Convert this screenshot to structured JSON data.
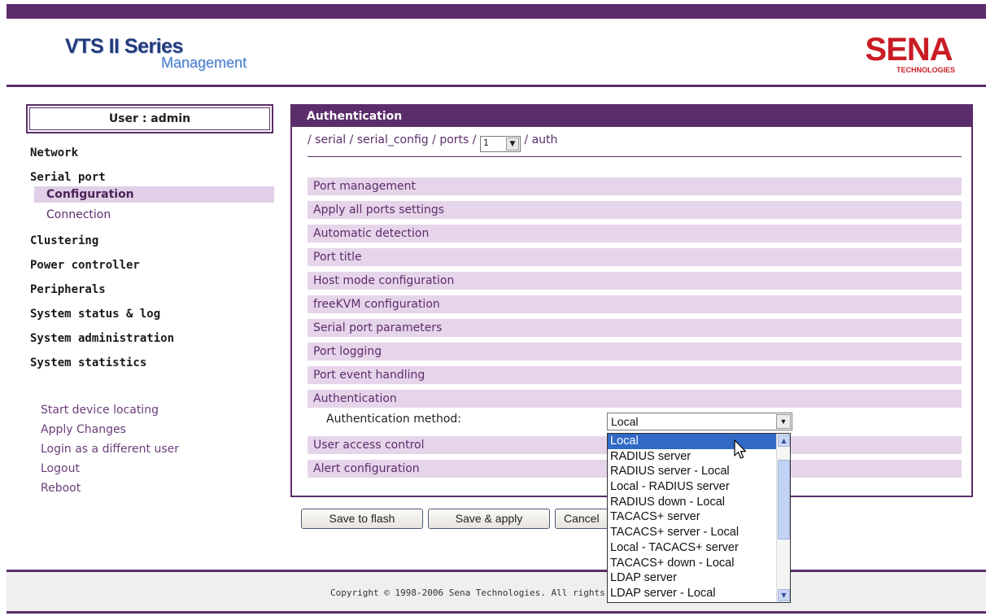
{
  "header": {
    "product_line1": "VTS II Series",
    "product_line2": "Management",
    "company_big": "SENA",
    "company_small": "TECHNOLOGIES"
  },
  "sidebar": {
    "user_label": "User : admin",
    "network": "Network",
    "serial_port": "Serial port",
    "serial_sub": {
      "configuration": "Configuration",
      "connection": "Connection"
    },
    "clustering": "Clustering",
    "power_controller": "Power controller",
    "peripherals": "Peripherals",
    "system_status": "System status & log",
    "system_admin": "System administration",
    "system_stats": "System statistics",
    "links": {
      "start_locating": "Start device locating",
      "apply_changes": "Apply Changes",
      "login_different": "Login as a different user",
      "logout": "Logout",
      "reboot": "Reboot"
    }
  },
  "panel": {
    "title": "Authentication",
    "breadcrumb": {
      "p1": "serial",
      "p2": "serial_config",
      "p3": "ports",
      "port_value": "1",
      "p4": "auth"
    },
    "sections": {
      "s1": "Port management",
      "s2": "Apply all ports settings",
      "s3": "Automatic detection",
      "s4": "Port title",
      "s5": "Host mode configuration",
      "s6": "freeKVM configuration",
      "s7": "Serial port parameters",
      "s8": "Port logging",
      "s9": "Port event handling",
      "s10": "Authentication",
      "s11": "User access control",
      "s12": "Alert configuration"
    },
    "auth_method_label": "Authentication method:",
    "auth_method_value": "Local"
  },
  "buttons": {
    "save_flash": "Save to flash",
    "save_apply": "Save & apply",
    "cancel": "Cancel"
  },
  "dropdown": {
    "o1": "Local",
    "o2": "RADIUS server",
    "o3": "RADIUS server - Local",
    "o4": "Local - RADIUS server",
    "o5": "RADIUS down - Local",
    "o6": "TACACS+ server",
    "o7": "TACACS+ server - Local",
    "o8": "Local - TACACS+ server",
    "o9": "TACACS+ down - Local",
    "o10": "LDAP server",
    "o11": "LDAP server - Local"
  },
  "footer": {
    "copyright": "Copyright © 1998-2006 Sena Technologies. All rights reserved."
  },
  "colors": {
    "brand_purple": "#5c2d6b",
    "section_bg": "#e6d5ea",
    "selected_blue": "#3169c6",
    "sena_red": "#c91c24"
  }
}
